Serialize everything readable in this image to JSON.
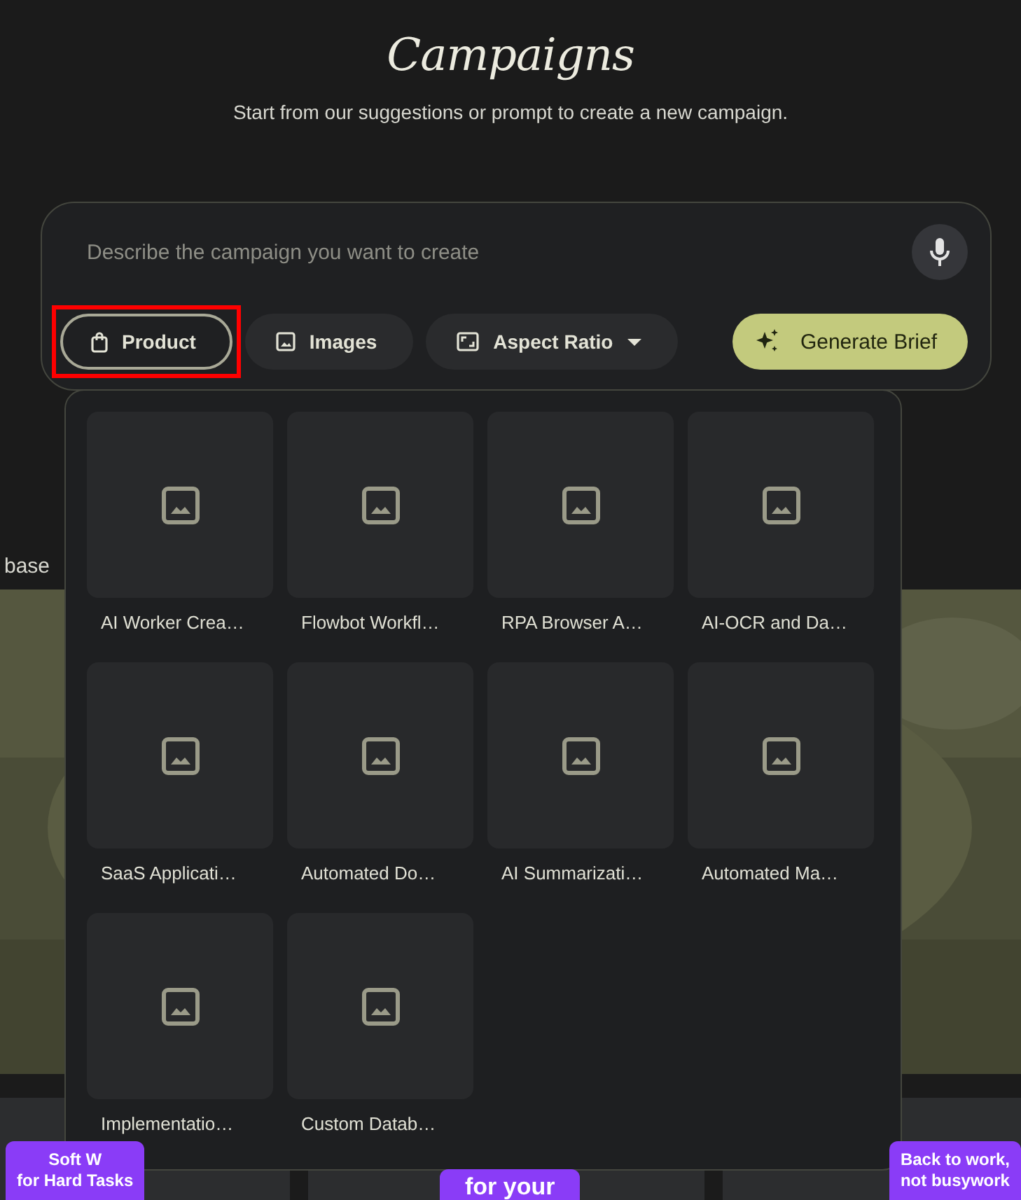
{
  "header": {
    "title": "Campaigns",
    "subtitle": "Start from our suggestions or prompt to create a new campaign."
  },
  "prompt": {
    "placeholder": "Describe the campaign you want to create",
    "generate_button": "Generate Brief",
    "chips": [
      {
        "kind": "product",
        "label": "Product",
        "selected": true,
        "annotated": true
      },
      {
        "kind": "images",
        "label": "Images",
        "selected": false,
        "annotated": false
      },
      {
        "kind": "aspect",
        "label": "Aspect Ratio",
        "selected": false,
        "annotated": false
      }
    ]
  },
  "background": {
    "snippet": "base",
    "badges": [
      {
        "lines": [
          "Soft W",
          "for Hard Tasks"
        ]
      },
      {
        "lines": [
          "for your"
        ]
      },
      {
        "lines": [
          "Back to work,",
          "not busywork"
        ]
      }
    ]
  },
  "product_menu": {
    "items": [
      {
        "label": "AI Worker Crea…"
      },
      {
        "label": "Flowbot Workfl…"
      },
      {
        "label": "RPA Browser A…"
      },
      {
        "label": "AI-OCR and Da…"
      },
      {
        "label": "SaaS Applicati…"
      },
      {
        "label": "Automated Do…"
      },
      {
        "label": "AI Summarizati…"
      },
      {
        "label": "Automated Ma…"
      },
      {
        "label": "Implementatio…"
      },
      {
        "label": "Custom Datab…"
      }
    ]
  }
}
